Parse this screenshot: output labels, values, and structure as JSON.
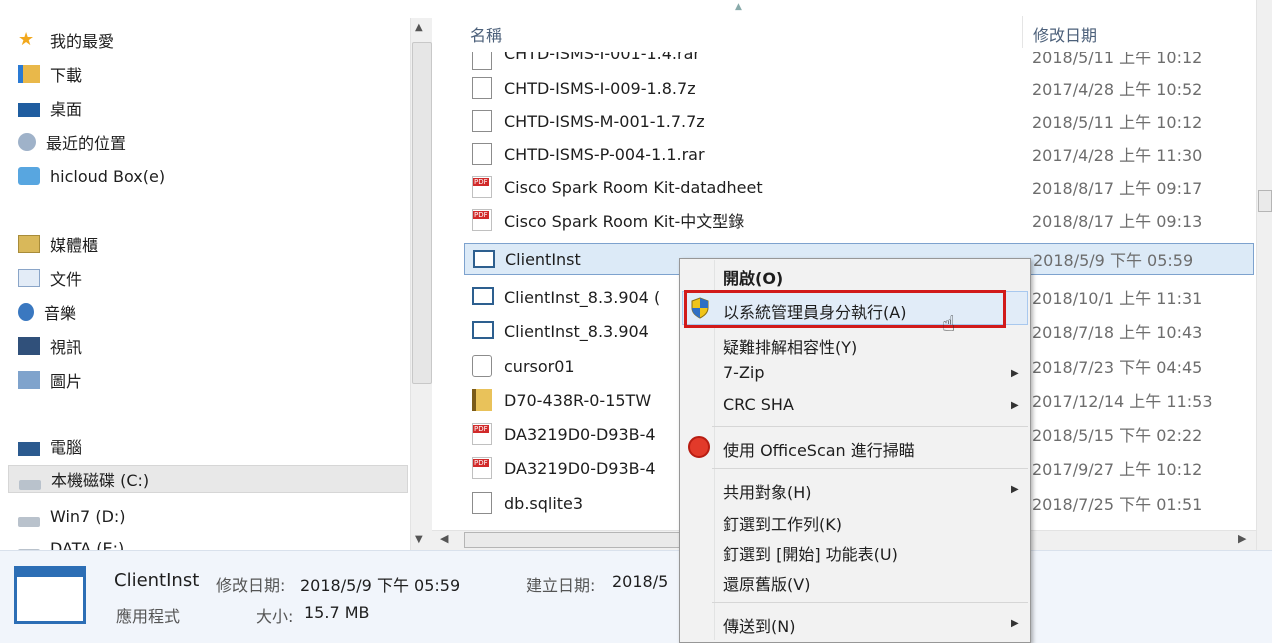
{
  "nav": {
    "favorites": "我的最愛",
    "downloads": "下載",
    "desktop": "桌面",
    "recent": "最近的位置",
    "hicloud": "hicloud Box(e)",
    "libraries": "媒體櫃",
    "documents": "文件",
    "music": "音樂",
    "videos": "視訊",
    "pictures": "圖片",
    "computer": "電腦",
    "drive_c": "本機磁碟 (C:)",
    "drive_d": "Win7 (D:)",
    "drive_e": "DATA (E:)"
  },
  "columns": {
    "name": "名稱",
    "date": "修改日期"
  },
  "files": [
    {
      "name": "CHTD-ISMS-I-001-1.4.rar",
      "date": "2018/5/11 上午 10:12",
      "icon": "file-icon"
    },
    {
      "name": "CHTD-ISMS-I-009-1.8.7z",
      "date": "2017/4/28 上午 10:52",
      "icon": "file-icon"
    },
    {
      "name": "CHTD-ISMS-M-001-1.7.7z",
      "date": "2018/5/11 上午 10:12",
      "icon": "file-icon"
    },
    {
      "name": "CHTD-ISMS-P-004-1.1.rar",
      "date": "2017/4/28 上午 11:30",
      "icon": "file-icon"
    },
    {
      "name": "Cisco Spark Room Kit-datadheet",
      "date": "2018/8/17 上午 09:17",
      "icon": "pdf-icon"
    },
    {
      "name": "Cisco Spark Room Kit-中文型錄",
      "date": "2018/8/17 上午 09:13",
      "icon": "pdf-icon"
    },
    {
      "name": "ClientInst",
      "date": "2018/5/9 下午 05:59",
      "icon": "app-icon"
    },
    {
      "name": "ClientInst_8.3.904 (",
      "date": "2018/10/1 上午 11:31",
      "icon": "app-icon"
    },
    {
      "name": "ClientInst_8.3.904",
      "date": "2018/7/18 上午 10:43",
      "icon": "app-icon"
    },
    {
      "name": "cursor01",
      "date": "2018/7/23 下午 04:45",
      "icon": "cursor-file-icon"
    },
    {
      "name": "D70-438R-0-15TW",
      "date": "2017/12/14 上午 11:53",
      "icon": "zip-folder-icon"
    },
    {
      "name": "DA3219D0-D93B-4",
      "date": "2018/5/15 下午 02:22",
      "icon": "pdf-icon"
    },
    {
      "name": "DA3219D0-D93B-4",
      "date": "2017/9/27 上午 10:12",
      "icon": "pdf-icon"
    },
    {
      "name": "db.sqlite3",
      "date": "2018/7/25 下午 01:51",
      "icon": "file-icon"
    }
  ],
  "context_menu": {
    "open": "開啟(O)",
    "run_as_admin": "以系統管理員身分執行(A)",
    "troubleshoot": "疑難排解相容性(Y)",
    "zip": "7-Zip",
    "crc": "CRC SHA",
    "officescan": "使用 OfficeScan 進行掃瞄",
    "share": "共用對象(H)",
    "pin_taskbar": "釘選到工作列(K)",
    "pin_start": "釘選到 [開始] 功能表(U)",
    "restore": "還原舊版(V)",
    "send_to": "傳送到(N)"
  },
  "status": {
    "name": "ClientInst",
    "modified_label": "修改日期:",
    "modified_value": "2018/5/9 下午 05:59",
    "created_label": "建立日期:",
    "created_value": "2018/5",
    "type": "應用程式",
    "size_label": "大小:",
    "size_value": "15.7 MB"
  },
  "colors": {
    "highlight_box": "#d11a1a",
    "selection": "#dceaf7"
  }
}
